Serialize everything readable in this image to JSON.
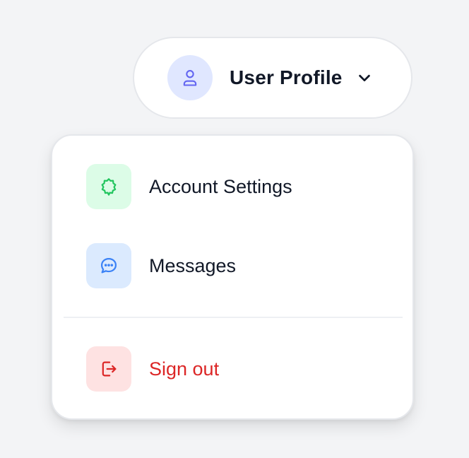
{
  "profile": {
    "label": "User Profile",
    "avatar_icon": "user-icon",
    "toggle_icon": "chevron-down-icon"
  },
  "menu": {
    "items": [
      {
        "label": "Account Settings",
        "icon": "gear-icon",
        "icon_color": "#22c55e",
        "icon_bg": "#dcfce7"
      },
      {
        "label": "Messages",
        "icon": "chat-bubble-icon",
        "icon_color": "#3b82f6",
        "icon_bg": "#dbeafe"
      }
    ],
    "sign_out": {
      "label": "Sign out",
      "icon": "logout-icon",
      "color": "#dc2626",
      "icon_bg": "#fee2e2"
    }
  },
  "colors": {
    "page_bg": "#f3f4f6",
    "avatar_bg": "#e0e7ff",
    "avatar_icon": "#6366f1"
  }
}
